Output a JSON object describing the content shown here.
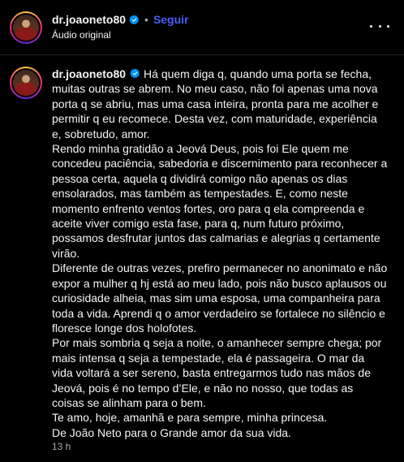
{
  "header": {
    "username": "dr.joaoneto80",
    "separator": "•",
    "follow_label": "Seguir",
    "audio_label": "Áudio original"
  },
  "caption": {
    "username": "dr.joaoneto80",
    "paragraphs": [
      "Há quem diga q, quando uma porta se fecha, muitas outras se abrem. No meu caso, não foi apenas uma nova porta q se abriu, mas uma casa inteira, pronta para me acolher e permitir q eu recomece. Desta vez, com maturidade, experiência e, sobretudo, amor.",
      "Rendo minha gratidão a Jeová Deus, pois foi Ele quem me concedeu paciência, sabedoria e discernimento para reconhecer a pessoa certa, aquela q dividirá comigo não apenas os dias ensolarados, mas também as tempestades. E, como neste momento enfrento ventos fortes, oro para q ela compreenda e aceite viver comigo esta fase, para q, num futuro próximo, possamos desfrutar juntos das calmarias e alegrias q certamente virão.",
      "Diferente de outras vezes, prefiro permanecer no anonimato e não expor a mulher q hj está ao meu lado, pois não busco aplausos ou curiosidade alheia, mas sim uma esposa, uma companheira para toda a vida. Aprendi q o amor verdadeiro se fortalece no silêncio e floresce longe dos holofotes.",
      "Por mais sombria q seja a noite, o amanhecer sempre chega; por mais intensa q seja a tempestade, ela é passageira. O mar da vida voltará a ser sereno, basta entregarmos tudo nas mãos de Jeová, pois é no tempo d’Ele, e não no nosso, que todas as coisas se alinham para o bem.",
      "Te amo, hoje, amanhã e para sempre, minha princesa.",
      "De João Neto para o Grande amor da sua vida."
    ],
    "time": "13 h"
  },
  "colors": {
    "background": "#000000",
    "text": "#f5f5f5",
    "secondary_text": "#a8a8a8",
    "follow": "#4a5df9",
    "verified": "#0095f6",
    "divider": "#262626"
  },
  "icons": {
    "verified": "verified-badge-icon",
    "more": "more-options-icon"
  }
}
